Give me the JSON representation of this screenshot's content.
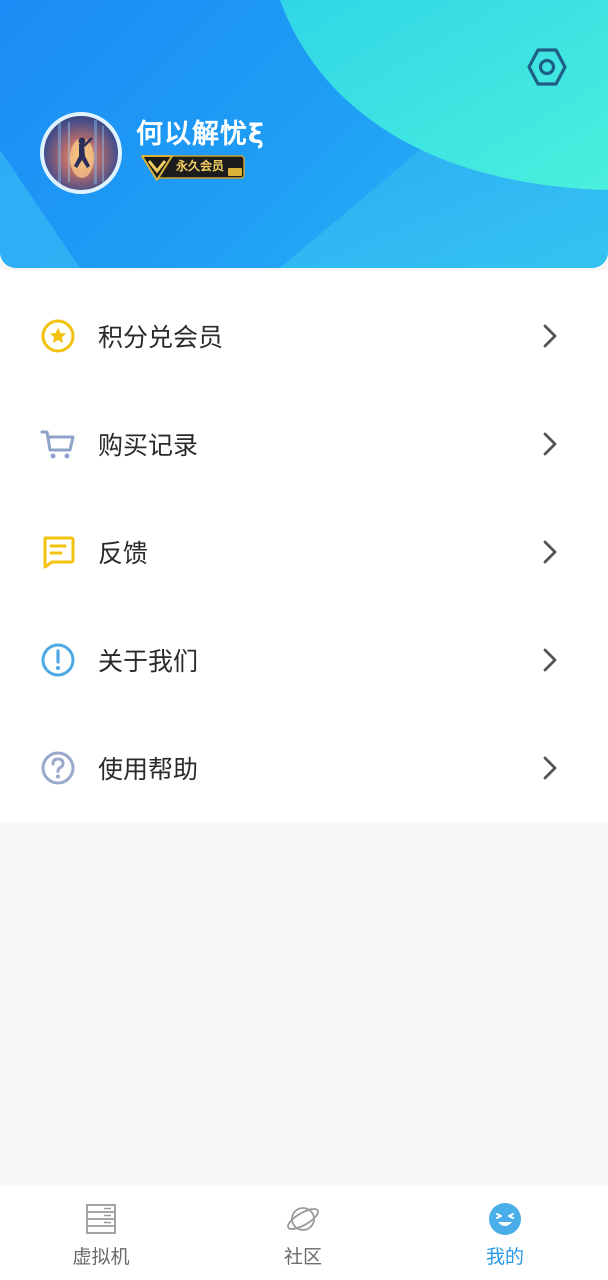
{
  "profile": {
    "username": "何以解忧ξ",
    "badge": "永久会员"
  },
  "menu": {
    "items": [
      {
        "label": "积分兑会员",
        "icon": "star-circle-icon",
        "color": "#f2c20f"
      },
      {
        "label": "购买记录",
        "icon": "cart-icon",
        "color": "#8fa3c9"
      },
      {
        "label": "反馈",
        "icon": "feedback-message-icon",
        "color": "#f2c20f"
      },
      {
        "label": "关于我们",
        "icon": "info-exclamation-icon",
        "color": "#4fa9e4"
      },
      {
        "label": "使用帮助",
        "icon": "help-question-icon",
        "color": "#9aa8cc"
      }
    ]
  },
  "tabbar": {
    "tabs": [
      {
        "label": "虚拟机",
        "icon": "server-icon",
        "active": false
      },
      {
        "label": "社区",
        "icon": "planet-icon",
        "active": false
      },
      {
        "label": "我的",
        "icon": "smiley-face-icon",
        "active": true
      }
    ]
  },
  "colors": {
    "accent": "#2a9ae8",
    "header_start": "#1b8cf5",
    "header_wave": "#3de0e0",
    "page_background": "#f7f7f7"
  }
}
